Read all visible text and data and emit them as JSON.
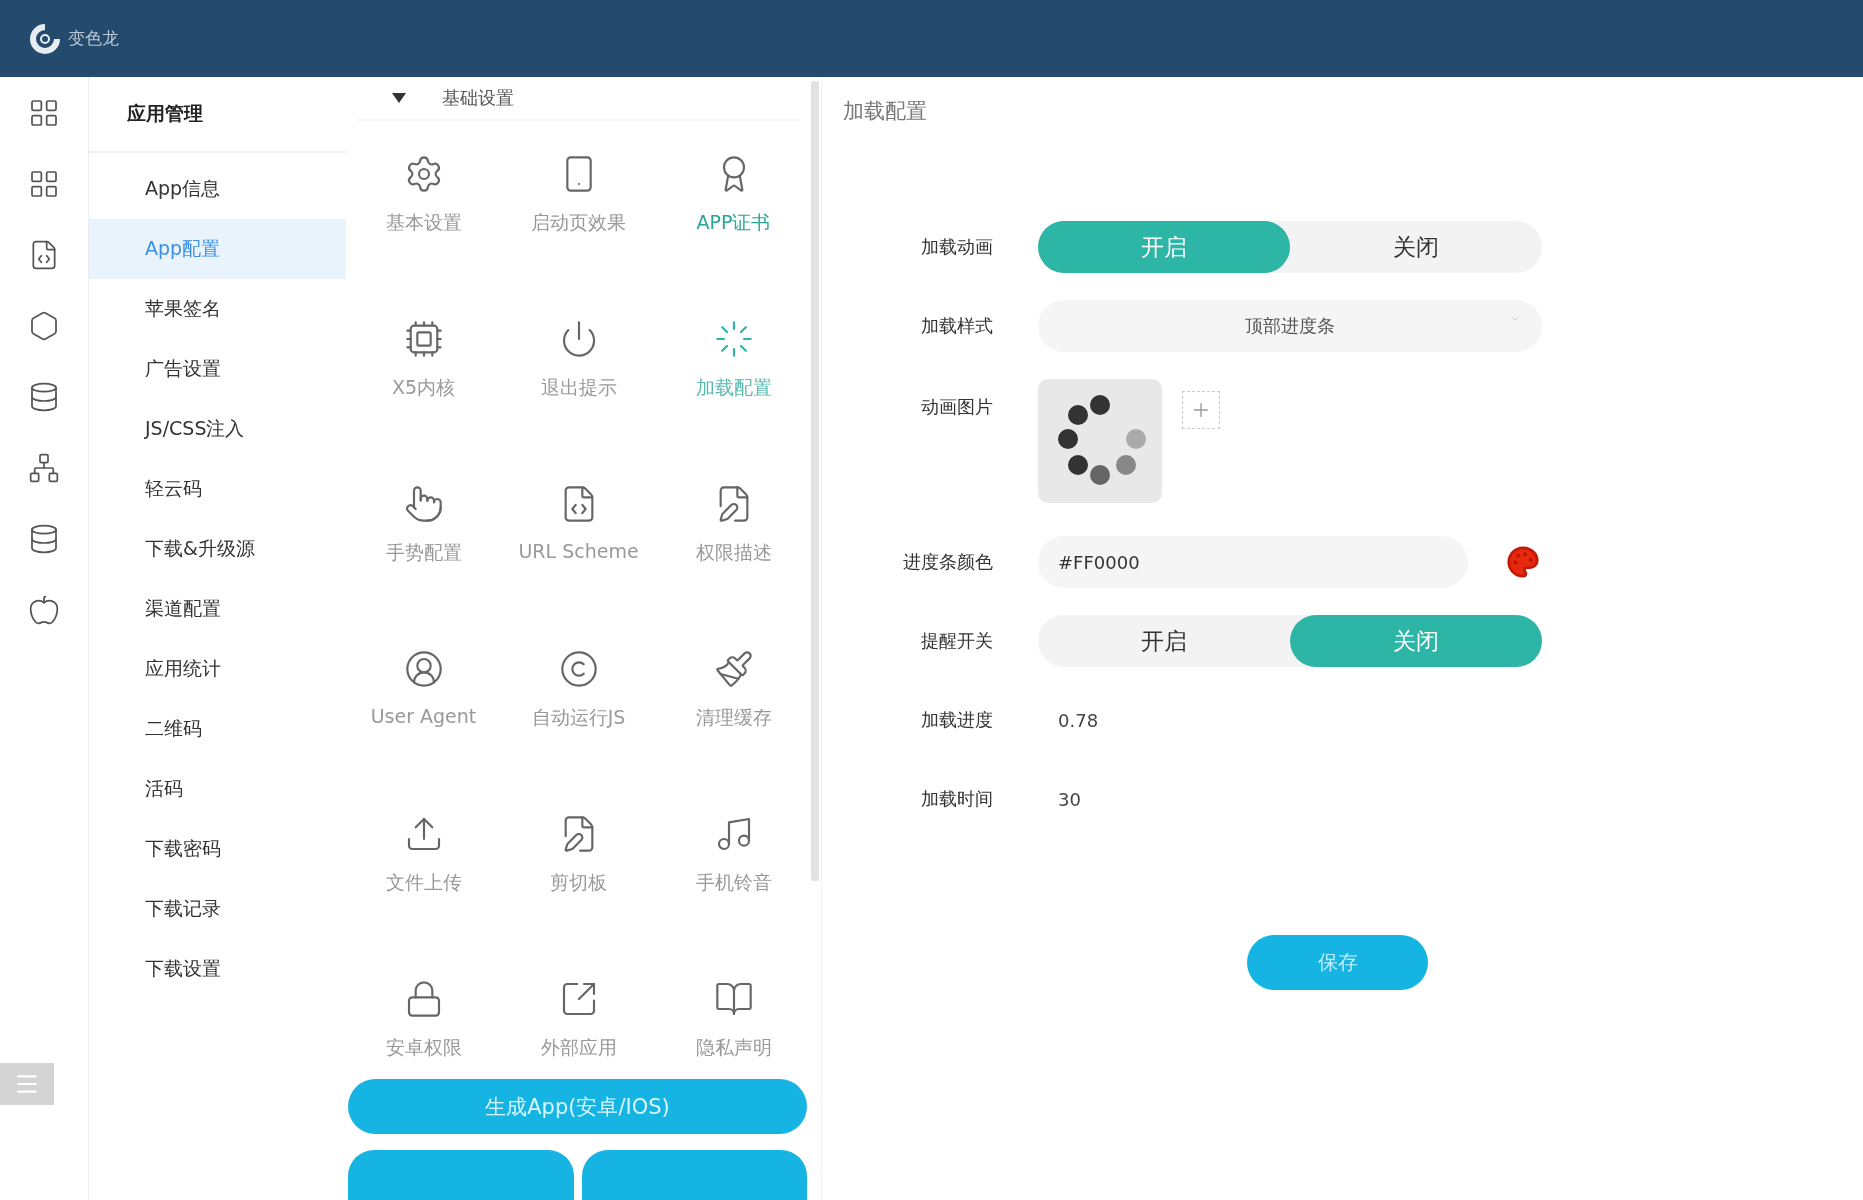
{
  "header": {
    "app_name": "变色龙"
  },
  "menu": {
    "title": "应用管理",
    "items": [
      {
        "label": "App信息",
        "selected": false
      },
      {
        "label": "App配置",
        "selected": true
      },
      {
        "label": "苹果签名",
        "selected": false
      },
      {
        "label": "广告设置",
        "selected": false
      },
      {
        "label": "JS/CSS注入",
        "selected": false
      },
      {
        "label": "轻云码",
        "selected": false
      },
      {
        "label": "下载&升级源",
        "selected": false
      },
      {
        "label": "渠道配置",
        "selected": false
      },
      {
        "label": "应用统计",
        "selected": false
      },
      {
        "label": "二维码",
        "selected": false
      },
      {
        "label": "活码",
        "selected": false
      },
      {
        "label": "下载密码",
        "selected": false
      },
      {
        "label": "下载记录",
        "selected": false
      },
      {
        "label": "下载设置",
        "selected": false
      }
    ]
  },
  "features": {
    "section": {
      "title": "基础设置",
      "expanded": true
    },
    "items": [
      {
        "label": "基本设置",
        "selected": false,
        "hover": false
      },
      {
        "label": "启动页效果",
        "selected": false,
        "hover": false
      },
      {
        "label": "APP证书",
        "selected": false,
        "hover": true
      },
      {
        "label": "X5内核",
        "selected": false,
        "hover": false
      },
      {
        "label": "退出提示",
        "selected": false,
        "hover": false
      },
      {
        "label": "加载配置",
        "selected": true,
        "hover": false
      },
      {
        "label": "手势配置",
        "selected": false,
        "hover": false
      },
      {
        "label": "URL Scheme",
        "selected": false,
        "hover": false
      },
      {
        "label": "权限描述",
        "selected": false,
        "hover": false
      },
      {
        "label": "User Agent",
        "selected": false,
        "hover": false
      },
      {
        "label": "自动运行JS",
        "selected": false,
        "hover": false
      },
      {
        "label": "清理缓存",
        "selected": false,
        "hover": false
      },
      {
        "label": "文件上传",
        "selected": false,
        "hover": false
      },
      {
        "label": "剪切板",
        "selected": false,
        "hover": false
      },
      {
        "label": "手机铃音",
        "selected": false,
        "hover": false
      },
      {
        "label": "安卓权限",
        "selected": false,
        "hover": false
      },
      {
        "label": "外部应用",
        "selected": false,
        "hover": false
      },
      {
        "label": "隐私声明",
        "selected": false,
        "hover": false
      }
    ],
    "generate_button": "生成App(安卓/IOS)"
  },
  "panel": {
    "title": "加载配置",
    "fields": [
      {
        "kind": "toggle",
        "label": "加载动画",
        "options": [
          {
            "label": "开启",
            "selected": true
          },
          {
            "label": "关闭",
            "selected": false
          }
        ]
      },
      {
        "kind": "select",
        "label": "加载样式",
        "value": "顶部进度条"
      },
      {
        "kind": "image",
        "label": "动画图片"
      },
      {
        "kind": "color",
        "label": "进度条颜色",
        "value": "#FF0000"
      },
      {
        "kind": "toggle",
        "label": "提醒开关",
        "options": [
          {
            "label": "开启",
            "selected": false
          },
          {
            "label": "关闭",
            "selected": true
          }
        ]
      },
      {
        "kind": "text",
        "label": "加载进度",
        "value": "0.78"
      },
      {
        "kind": "text",
        "label": "加载时间",
        "value": "30"
      }
    ],
    "save_button": "保存"
  }
}
